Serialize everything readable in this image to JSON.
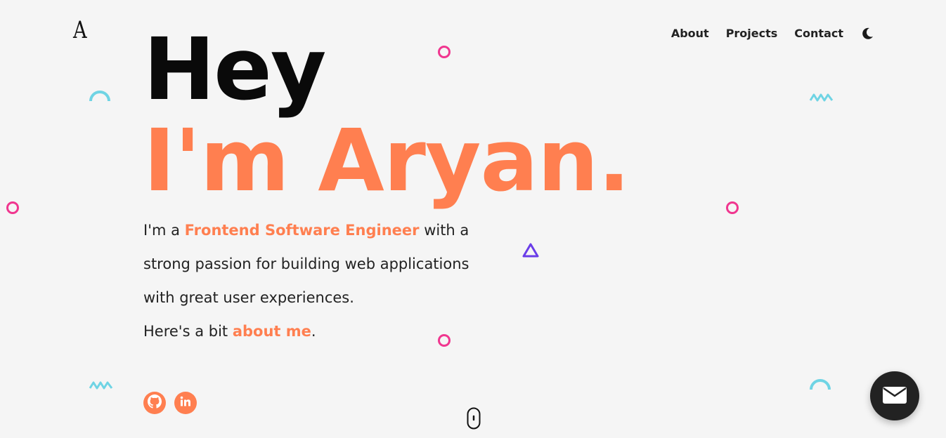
{
  "brand": {
    "logo_letter": "A"
  },
  "nav": {
    "items": [
      {
        "label": "About"
      },
      {
        "label": "Projects"
      },
      {
        "label": "Contact"
      }
    ],
    "theme_icon": "moon-icon"
  },
  "hero": {
    "greeting": "Hey",
    "name_line": "I'm Aryan.",
    "bio": {
      "intro": "I'm a",
      "role": "Frontend Software Engineer",
      "rest": "with a strong passion for building web applications with great user experiences.",
      "more_prefix": "Here's a bit",
      "more_link": "about me",
      "more_suffix": "."
    }
  },
  "socials": [
    {
      "icon": "github-icon"
    },
    {
      "icon": "linkedin-icon"
    }
  ],
  "scroll_indicator": {
    "icon": "mouse-scroll-icon"
  },
  "contact_fab": {
    "icon": "envelope-icon"
  },
  "colors": {
    "accent": "#ff7f50",
    "background": "#f5f5f5",
    "text": "#222222",
    "deco_pink": "#f0368f",
    "deco_cyan": "#6fd4e4",
    "deco_purple": "#6a3de8"
  }
}
